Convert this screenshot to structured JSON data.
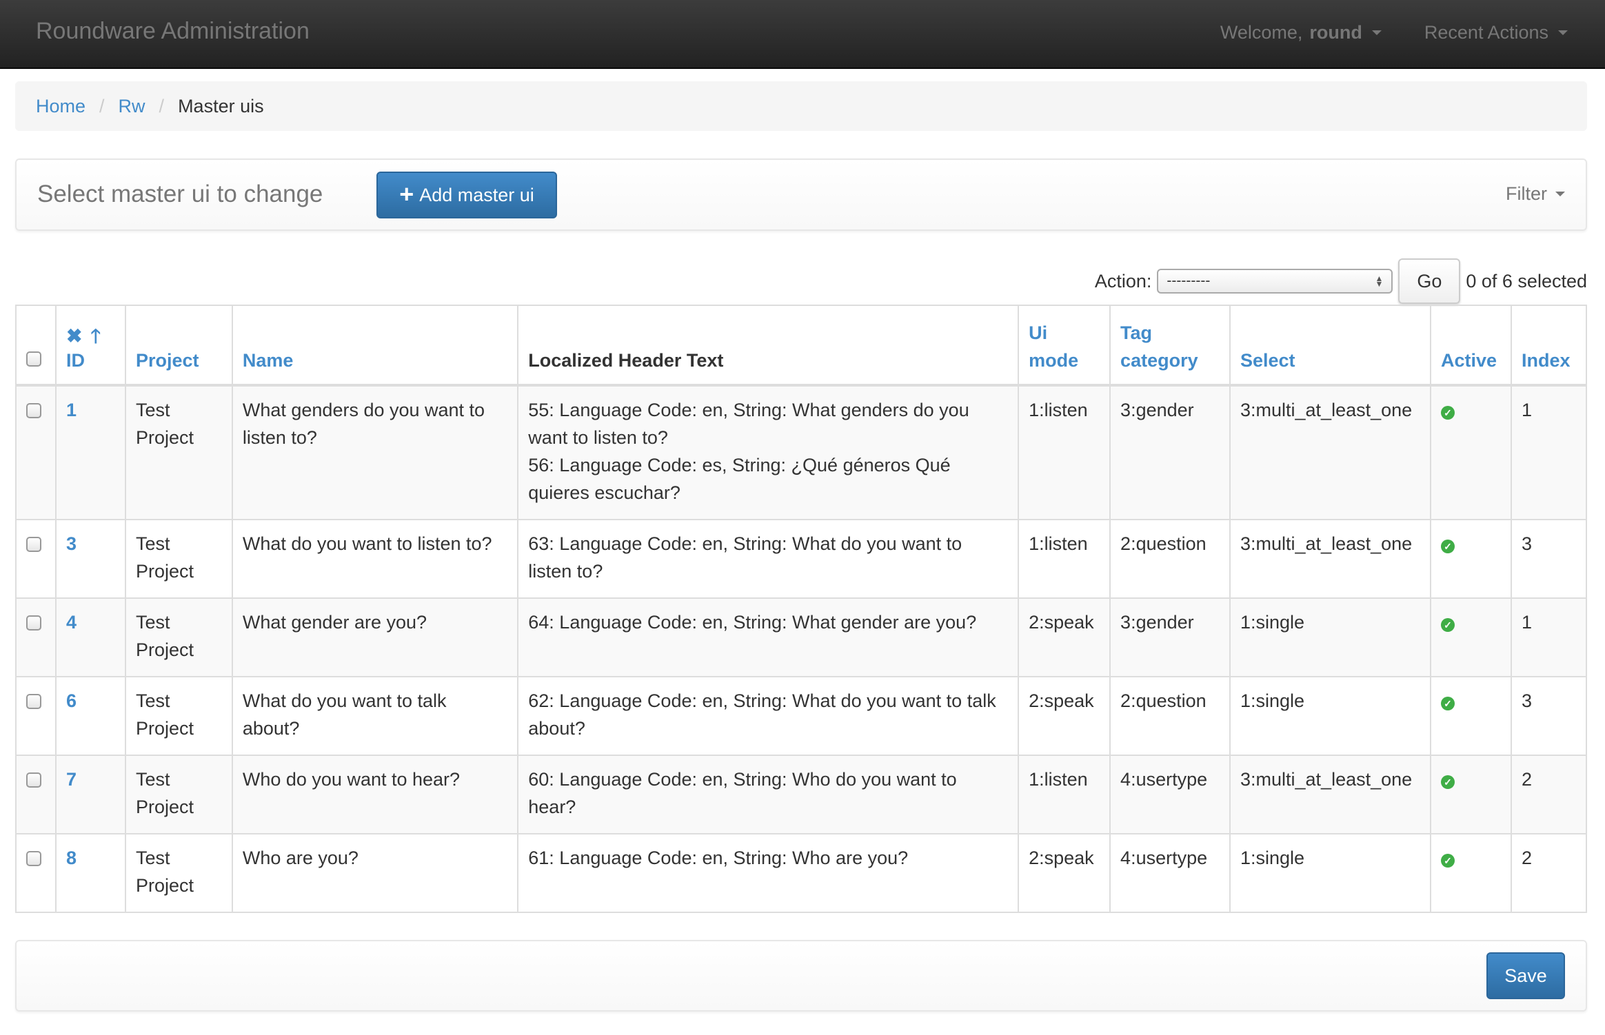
{
  "navbar": {
    "brand": "Roundware Administration",
    "welcome_prefix": "Welcome,",
    "username": "round",
    "recent_actions": "Recent Actions"
  },
  "breadcrumb": {
    "items": [
      "Home",
      "Rw"
    ],
    "current": "Master uis",
    "separator": "/"
  },
  "toolbar": {
    "title": "Select master ui to change",
    "add_button": "Add master ui",
    "filter_label": "Filter"
  },
  "actions": {
    "label": "Action:",
    "selected_value": "---------",
    "go_button": "Go",
    "selection_status": "0 of 6 selected"
  },
  "table": {
    "columns": {
      "id": "ID",
      "project": "Project",
      "name": "Name",
      "localized_header_text": "Localized Header Text",
      "ui_mode_line1": "Ui",
      "ui_mode_line2": "mode",
      "tag_category_line1": "Tag",
      "tag_category_line2": "category",
      "select": "Select",
      "active": "Active",
      "index": "Index"
    },
    "rows": [
      {
        "id": "1",
        "project": "Test Project",
        "name": "What genders do you want to listen to?",
        "header_text": [
          "55: Language Code: en, String: What genders do you want to listen to?",
          "56: Language Code: es, String: ¿Qué géneros Qué quieres escuchar?"
        ],
        "ui_mode": "1:listen",
        "tag_category": "3:gender",
        "select": "3:multi_at_least_one",
        "active": true,
        "index": "1"
      },
      {
        "id": "3",
        "project": "Test Project",
        "name": "What do you want to listen to?",
        "header_text": [
          "63: Language Code: en, String: What do you want to listen to?"
        ],
        "ui_mode": "1:listen",
        "tag_category": "2:question",
        "select": "3:multi_at_least_one",
        "active": true,
        "index": "3"
      },
      {
        "id": "4",
        "project": "Test Project",
        "name": "What gender are you?",
        "header_text": [
          "64: Language Code: en, String: What gender are you?"
        ],
        "ui_mode": "2:speak",
        "tag_category": "3:gender",
        "select": "1:single",
        "active": true,
        "index": "1"
      },
      {
        "id": "6",
        "project": "Test Project",
        "name": "What do you want to talk about?",
        "header_text": [
          "62: Language Code: en, String: What do you want to talk about?"
        ],
        "ui_mode": "2:speak",
        "tag_category": "2:question",
        "select": "1:single",
        "active": true,
        "index": "3"
      },
      {
        "id": "7",
        "project": "Test Project",
        "name": "Who do you want to hear?",
        "header_text": [
          "60: Language Code: en, String: Who do you want to hear?"
        ],
        "ui_mode": "1:listen",
        "tag_category": "4:usertype",
        "select": "3:multi_at_least_one",
        "active": true,
        "index": "2"
      },
      {
        "id": "8",
        "project": "Test Project",
        "name": "Who are you?",
        "header_text": [
          "61: Language Code: en, String: Who are you?"
        ],
        "ui_mode": "2:speak",
        "tag_category": "4:usertype",
        "select": "1:single",
        "active": true,
        "index": "2"
      }
    ]
  },
  "footer": {
    "save_button": "Save"
  },
  "icons": {
    "sort_remove": "✖",
    "sort_asc": "🡑",
    "plus": "+",
    "active_true": "✓"
  },
  "colors": {
    "link": "#428bca",
    "primary_button": "#3071a9",
    "active_icon": "#3fad46",
    "navbar": "#222222"
  }
}
